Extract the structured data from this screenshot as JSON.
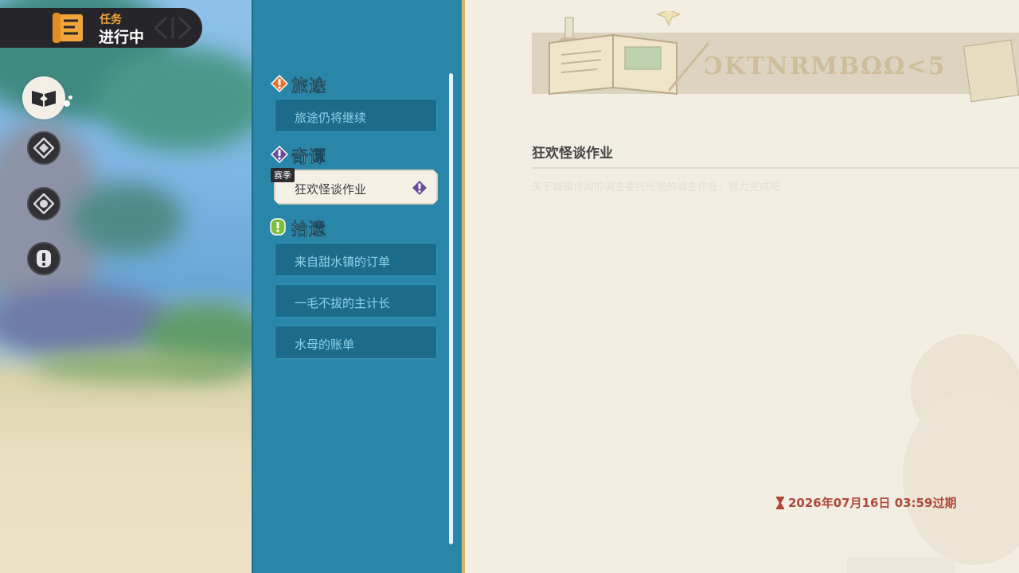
{
  "header": {
    "category_label": "任务",
    "status_label": "进行中"
  },
  "nav": {
    "items": [
      {
        "icon": "book-icon",
        "active": true
      },
      {
        "icon": "diamond-emblem-icon",
        "active": false
      },
      {
        "icon": "compass-emblem-icon",
        "active": false
      },
      {
        "icon": "exclamation-icon",
        "active": false
      }
    ]
  },
  "categories": [
    {
      "title": "旅途",
      "icon": "orange-exclamation-icon",
      "color": "#e8732a",
      "items": [
        {
          "label": "旅途仍将继续",
          "selected": false
        }
      ]
    },
    {
      "title": "奇谭",
      "icon": "purple-exclamation-icon",
      "color": "#6b4b9a",
      "items": [
        {
          "label": "狂欢怪谈作业",
          "selected": true,
          "tag": "赛季"
        }
      ]
    },
    {
      "title": "拾遗",
      "icon": "green-exclamation-icon",
      "color": "#7cbf3a",
      "items": [
        {
          "label": "来自甜水镇的订单",
          "selected": false
        },
        {
          "label": "一毛不拔的主计长",
          "selected": false
        },
        {
          "label": "水母的账单",
          "selected": false
        }
      ]
    }
  ],
  "detail": {
    "banner_title": "ƆKTNRMBΩΩ<5",
    "title": "狂欢怪谈作业",
    "description": "关于城镇传闻的调查委托所需的调查作业，努力完成吧",
    "expiry": "2026年07月16日 03:59过期",
    "expiry_color": "#b0483a"
  }
}
